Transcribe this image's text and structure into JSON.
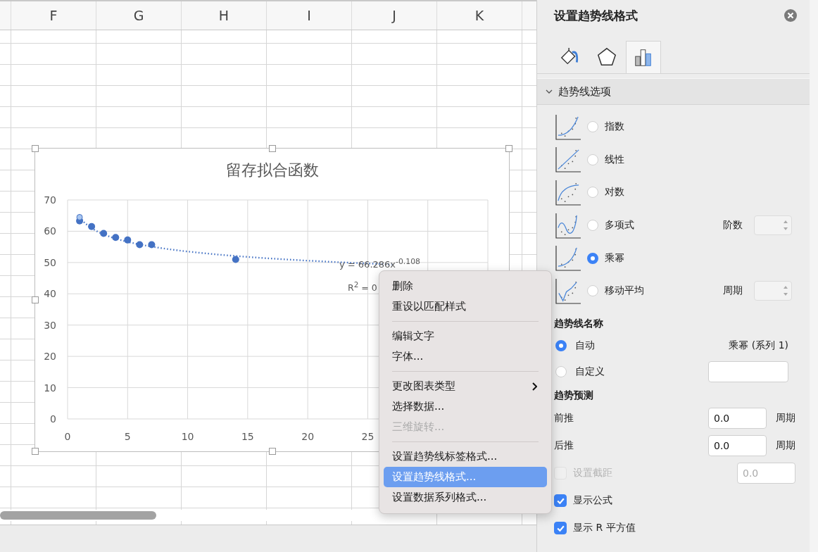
{
  "spreadsheet": {
    "columns": [
      "F",
      "G",
      "H",
      "I",
      "J",
      "K"
    ]
  },
  "chart": {
    "title": "留存拟合函数",
    "selected": true,
    "trendline_label": {
      "equation": "y = 66.286x$^{-0.108}$",
      "r_squared": "R$^{2}$ = 0"
    },
    "chart_data": {
      "type": "scatter",
      "grid": true,
      "xlim": [
        0,
        35
      ],
      "ylim": [
        0,
        70
      ],
      "xticks": [
        0,
        5,
        10,
        15,
        20,
        25
      ],
      "yticks": [
        0,
        10,
        20,
        30,
        40,
        50,
        60,
        70
      ],
      "x": [
        1,
        2,
        3,
        4,
        5,
        6,
        7,
        14
      ],
      "series": [
        {
          "color": "#4472c4",
          "values": [
            63.3,
            61.5,
            59.3,
            58,
            57.2,
            55.7,
            55.7,
            51
          ]
        }
      ]
    }
  },
  "context_menu": {
    "groups": [
      [
        {
          "label": "删除",
          "disabled": false,
          "selected": false,
          "submenu": false
        },
        {
          "label": "重设以匹配样式",
          "disabled": false,
          "selected": false,
          "submenu": false
        }
      ],
      [
        {
          "label": "编辑文字",
          "disabled": false,
          "selected": false,
          "submenu": false
        },
        {
          "label": "字体...",
          "disabled": false,
          "selected": false,
          "submenu": false
        }
      ],
      [
        {
          "label": "更改图表类型",
          "disabled": false,
          "selected": false,
          "submenu": true
        },
        {
          "label": "选择数据...",
          "disabled": false,
          "selected": false,
          "submenu": false
        },
        {
          "label": "三维旋转...",
          "disabled": true,
          "selected": false,
          "submenu": false
        }
      ],
      [
        {
          "label": "设置趋势线标签格式...",
          "disabled": false,
          "selected": false,
          "submenu": false
        },
        {
          "label": "设置趋势线格式...",
          "disabled": false,
          "selected": true,
          "submenu": false
        },
        {
          "label": "设置数据系列格式...",
          "disabled": false,
          "selected": false,
          "submenu": false
        }
      ]
    ]
  },
  "panel": {
    "title": "设置趋势线格式",
    "tabs": [
      {
        "kind": "fill",
        "selected": false
      },
      {
        "kind": "shape",
        "selected": false
      },
      {
        "kind": "options",
        "selected": true
      }
    ],
    "section": {
      "label": "趋势线选项",
      "expanded": true
    },
    "trend_types": [
      {
        "kind": "exponential",
        "label": "指数",
        "selected": false
      },
      {
        "kind": "linear",
        "label": "线性",
        "selected": false
      },
      {
        "kind": "logarithmic",
        "label": "对数",
        "selected": false
      },
      {
        "kind": "polynomial",
        "label": "多项式",
        "selected": false,
        "param_label": "阶数"
      },
      {
        "kind": "power",
        "label": "乘幂",
        "selected": true
      },
      {
        "kind": "moving_average",
        "label": "移动平均",
        "selected": false,
        "param_label": "周期"
      }
    ],
    "name_heading": "趋势线名称",
    "name_options": [
      {
        "kind": "auto",
        "label": "自动",
        "selected": true,
        "value": "乘幂 (系列 1)"
      },
      {
        "kind": "custom",
        "label": "自定义",
        "selected": false
      }
    ],
    "forecast_heading": "趋势预测",
    "forecast": [
      {
        "label": "前推",
        "value": "0.0",
        "unit": "周期"
      },
      {
        "label": "后推",
        "value": "0.0",
        "unit": "周期"
      }
    ],
    "intercept": {
      "label": "设置截距",
      "checked": false,
      "disabled": true,
      "value": "0.0"
    },
    "checks": [
      {
        "label": "显示公式",
        "checked": true
      },
      {
        "label": "显示 R 平方值",
        "checked": true
      }
    ]
  }
}
